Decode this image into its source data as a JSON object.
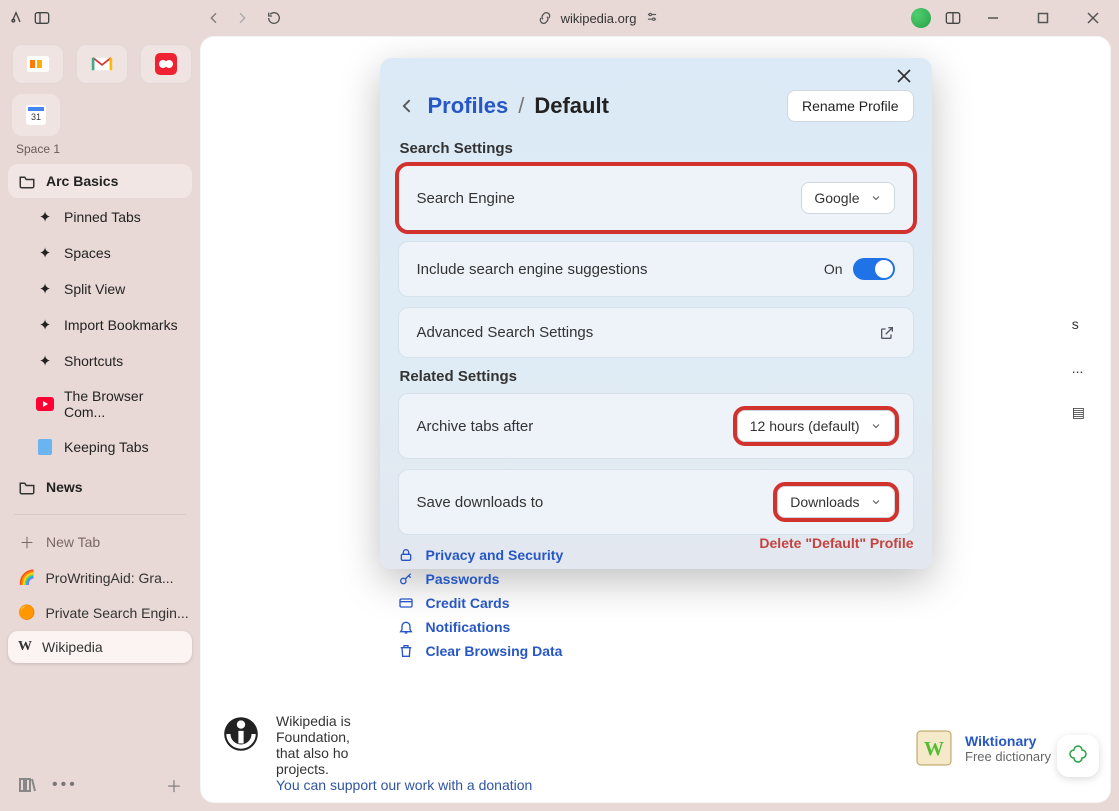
{
  "titlebar": {
    "host": "wikipedia.org"
  },
  "sidebar": {
    "space_label": "Space 1",
    "folders": {
      "arc_basics": "Arc Basics",
      "news": "News"
    },
    "items": {
      "pinned_tabs": "Pinned Tabs",
      "spaces": "Spaces",
      "split_view": "Split View",
      "import_bookmarks": "Import Bookmarks",
      "shortcuts": "Shortcuts",
      "browser_company": "The Browser Com...",
      "keeping_tabs": "Keeping Tabs"
    },
    "new_tab": "New Tab",
    "tabs": {
      "prowritingaid": "ProWritingAid: Gra...",
      "private_search": "Private Search Engin...",
      "wikipedia": "Wikipedia"
    }
  },
  "background": {
    "s": "s",
    "ellipsis": "...",
    "footer_line1_a": "Wikipedia is",
    "footer_line1_b": "Foundation,",
    "footer_line1_c": "that also ho",
    "footer_line1_d": "projects.",
    "footer_link": "You can support our work with a donation",
    "wiktionary": "Wiktionary",
    "wiktionary_sub": "Free dictionary"
  },
  "modal": {
    "breadcrumb_root": "Profiles",
    "breadcrumb_sep": "/",
    "breadcrumb_current": "Default",
    "rename": "Rename Profile",
    "search_settings": "Search Settings",
    "search_engine_label": "Search Engine",
    "search_engine_value": "Google",
    "suggestions_label": "Include search engine suggestions",
    "suggestions_state": "On",
    "advanced_search": "Advanced Search Settings",
    "related_settings": "Related Settings",
    "archive_label": "Archive tabs after",
    "archive_value": "12 hours (default)",
    "downloads_label": "Save downloads to",
    "downloads_value": "Downloads",
    "links": {
      "privacy": "Privacy and Security",
      "passwords": "Passwords",
      "credit_cards": "Credit Cards",
      "notifications": "Notifications",
      "clear_data": "Clear Browsing Data"
    },
    "delete": "Delete \"Default\" Profile"
  }
}
